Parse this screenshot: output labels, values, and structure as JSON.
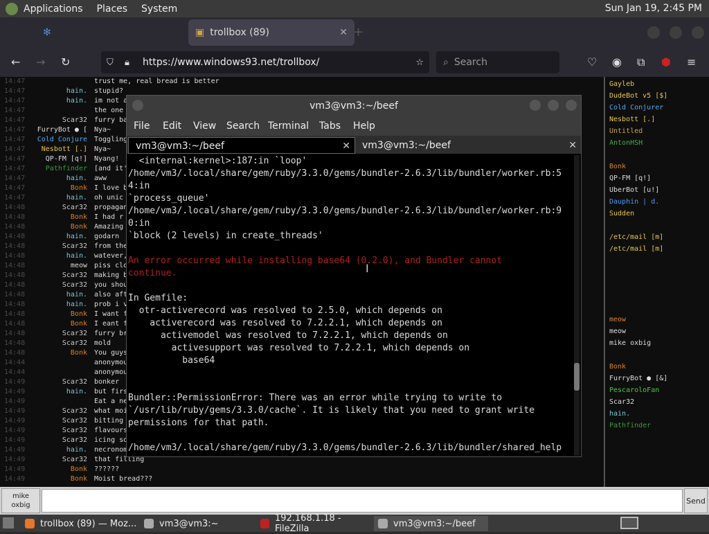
{
  "panel": {
    "applications": "Applications",
    "places": "Places",
    "system": "System",
    "clock": "Sun Jan 19,  2:45 PM"
  },
  "browser": {
    "tab_inactive": "",
    "tab_active": "trollbox (89)",
    "url": "https://www.windows93.net/trollbox/",
    "search_placeholder": "Search"
  },
  "chat": {
    "rows": [
      {
        "t": "14:47",
        "n": "",
        "nc": "#cc2222",
        "m": "trust me, real bread is better"
      },
      {
        "t": "14:47",
        "n": "hain.",
        "nc": "#7fc7d8",
        "m": "stupid?"
      },
      {
        "t": "14:47",
        "n": "hain.",
        "nc": "#7fc7d8",
        "m": "im not a"
      },
      {
        "t": "14:47",
        "n": "",
        "nc": "#cc2222",
        "m": "the one"
      },
      {
        "t": "14:47",
        "n": "Scar32",
        "nc": "#cccccc",
        "m": "furry ba"
      },
      {
        "t": "14:47",
        "n": "FurryBot ● [",
        "nc": "#dddddd",
        "m": "Nya~"
      },
      {
        "t": "14:47",
        "n": "Cold Conjure",
        "nc": "#55aaee",
        "m": "Toggling"
      },
      {
        "t": "14:47",
        "n": "Nesbott [.]",
        "nc": "#e8c84a",
        "m": "Nya~"
      },
      {
        "t": "14:47",
        "n": "QP-FM [q!]",
        "nc": "#dddddd",
        "m": "Nyang!"
      },
      {
        "t": "14:47",
        "n": "Pathfinder",
        "nc": "#3a9a3a",
        "m": "[and it'"
      },
      {
        "t": "14:47",
        "n": "hain.",
        "nc": "#7fc7d8",
        "m": "aww"
      },
      {
        "t": "14:47",
        "n": "Bonk",
        "nc": "#d9822b",
        "m": "I love b"
      },
      {
        "t": "14:47",
        "n": "hain.",
        "nc": "#7fc7d8",
        "m": "oh unic"
      },
      {
        "t": "14:48",
        "n": "Scar32",
        "nc": "#cccccc",
        "m": "propagan"
      },
      {
        "t": "14:48",
        "n": "Bonk",
        "nc": "#d9822b",
        "m": "I had r"
      },
      {
        "t": "14:48",
        "n": "Bonk",
        "nc": "#d9822b",
        "m": "Amazing"
      },
      {
        "t": "14:48",
        "n": "hain.",
        "nc": "#7fc7d8",
        "m": "godarn"
      },
      {
        "t": "14:48",
        "n": "Scar32",
        "nc": "#cccccc",
        "m": "from the"
      },
      {
        "t": "14:48",
        "n": "hain.",
        "nc": "#7fc7d8",
        "m": "watever,"
      },
      {
        "t": "14:48",
        "n": "meow",
        "nc": "#dddddd",
        "m": "piss clo"
      },
      {
        "t": "14:48",
        "n": "Scar32",
        "nc": "#cccccc",
        "m": "making b"
      },
      {
        "t": "14:48",
        "n": "Scar32",
        "nc": "#cccccc",
        "m": "you shou"
      },
      {
        "t": "14:48",
        "n": "hain.",
        "nc": "#7fc7d8",
        "m": "also aft"
      },
      {
        "t": "14:48",
        "n": "hain.",
        "nc": "#7fc7d8",
        "m": "prob i v"
      },
      {
        "t": "14:48",
        "n": "Bonk",
        "nc": "#d9822b",
        "m": "I want f"
      },
      {
        "t": "14:48",
        "n": "Bonk",
        "nc": "#d9822b",
        "m": "I eant f"
      },
      {
        "t": "14:48",
        "n": "Scar32",
        "nc": "#cccccc",
        "m": "furry br"
      },
      {
        "t": "14:48",
        "n": "Scar32",
        "nc": "#cccccc",
        "m": "mold"
      },
      {
        "t": "14:48",
        "n": "Bonk",
        "nc": "#d9822b",
        "m": "You guys"
      },
      {
        "t": "14:44",
        "n": "",
        "nc": "#cc2222",
        "m": "anonymou"
      },
      {
        "t": "14:44",
        "n": "",
        "nc": "#cc2222",
        "m": "anonymou"
      },
      {
        "t": "14:49",
        "n": "Scar32",
        "nc": "#cccccc",
        "m": "bonker"
      },
      {
        "t": "14:49",
        "n": "hain.",
        "nc": "#7fc7d8",
        "m": "but firs"
      },
      {
        "t": "14:49",
        "n": "",
        "nc": "#2255cc",
        "m": "Eat a ne"
      },
      {
        "t": "14:49",
        "n": "Scar32",
        "nc": "#cccccc",
        "m": "what moi"
      },
      {
        "t": "14:49",
        "n": "Scar32",
        "nc": "#cccccc",
        "m": "bitting"
      },
      {
        "t": "14:49",
        "n": "Scar32",
        "nc": "#cccccc",
        "m": "flavours"
      },
      {
        "t": "14:49",
        "n": "Scar32",
        "nc": "#cccccc",
        "m": "icing so"
      },
      {
        "t": "14:49",
        "n": "hain.",
        "nc": "#7fc7d8",
        "m": "necronom"
      },
      {
        "t": "14:49",
        "n": "Scar32",
        "nc": "#cccccc",
        "m": "that filling"
      },
      {
        "t": "14:49",
        "n": "Bonk",
        "nc": "#d9822b",
        "m": "??????"
      },
      {
        "t": "14:49",
        "n": "Bonk",
        "nc": "#d9822b",
        "m": "Moist bread???"
      }
    ]
  },
  "users": [
    {
      "n": "Gayleb",
      "c": "#e8c84a"
    },
    {
      "n": "DudeBot v5 [$]",
      "c": "#e8c84a"
    },
    {
      "n": "Cold Conjurer",
      "c": "#55aaee"
    },
    {
      "n": "Nesbott [.]",
      "c": "#e8c84a"
    },
    {
      "n": "Untitled",
      "c": "#c8a84a"
    },
    {
      "n": "AntonHSH",
      "c": "#4aa84a"
    },
    {
      "n": "",
      "c": "#3a6a6a"
    },
    {
      "n": "Bonk",
      "c": "#d9822b"
    },
    {
      "n": "QP-FM [q!]",
      "c": "#dddddd"
    },
    {
      "n": "UberBot [u!]",
      "c": "#dddddd"
    },
    {
      "n": "Dauphin | d.",
      "c": "#5599ee"
    },
    {
      "n": "Sudden",
      "c": "#e8c84a"
    },
    {
      "n": "",
      "c": "#2244cc"
    },
    {
      "n": "/etc/mail [m]",
      "c": "#e8c84a"
    },
    {
      "n": "/etc/mail [m]",
      "c": "#e8c84a"
    },
    {
      "n": "",
      "c": "#2244cc"
    },
    {
      "n": "",
      "c": "#3a5a3a"
    },
    {
      "n": "",
      "c": "#cc2222"
    },
    {
      "n": "",
      "c": "#888888"
    },
    {
      "n": "",
      "c": "#cc2222"
    },
    {
      "n": "meow",
      "c": "#d9822b"
    },
    {
      "n": "meow",
      "c": "#dddddd"
    },
    {
      "n": "mike oxbig",
      "c": "#dddddd"
    },
    {
      "n": "",
      "c": "#2244cc"
    },
    {
      "n": "Bonk",
      "c": "#d9822b"
    },
    {
      "n": "FurryBot ● [&]",
      "c": "#dddddd"
    },
    {
      "n": "PescaroloFan",
      "c": "#4ac84a"
    },
    {
      "n": "Scar32",
      "c": "#dddddd"
    },
    {
      "n": "hain.",
      "c": "#7fc7d8"
    },
    {
      "n": "Pathfinder",
      "c": "#3a9a3a"
    }
  ],
  "input": {
    "user_line1": "mike",
    "user_line2": "oxbig",
    "send": "Send"
  },
  "terminal": {
    "title": "vm3@vm3:~/beef",
    "menu": [
      "File",
      "Edit",
      "View",
      "Search",
      "Terminal",
      "Tabs",
      "Help"
    ],
    "tab1": "vm3@vm3:~/beef",
    "tab2": "vm3@vm3:~/beef",
    "lines": [
      {
        "s": "  <internal:kernel>:187:in `loop'",
        "c": "#dddddd"
      },
      {
        "s": "/home/vm3/.local/share/gem/ruby/3.3.0/gems/bundler-2.6.3/lib/bundler/worker.rb:5",
        "c": "#dddddd"
      },
      {
        "s": "4:in",
        "c": "#dddddd"
      },
      {
        "s": "`process_queue'",
        "c": "#dddddd"
      },
      {
        "s": "/home/vm3/.local/share/gem/ruby/3.3.0/gems/bundler-2.6.3/lib/bundler/worker.rb:9",
        "c": "#dddddd"
      },
      {
        "s": "0:in",
        "c": "#dddddd"
      },
      {
        "s": "`block (2 levels) in create_threads'",
        "c": "#dddddd"
      },
      {
        "s": "",
        "c": "#dddddd"
      },
      {
        "s": "An error occurred while installing base64 (0.2.0), and Bundler cannot",
        "c": "#b02020"
      },
      {
        "s": "continue.",
        "c": "#b02020"
      },
      {
        "s": "",
        "c": "#dddddd"
      },
      {
        "s": "In Gemfile:",
        "c": "#dddddd"
      },
      {
        "s": "  otr-activerecord was resolved to 2.5.0, which depends on",
        "c": "#dddddd"
      },
      {
        "s": "    activerecord was resolved to 7.2.2.1, which depends on",
        "c": "#dddddd"
      },
      {
        "s": "      activemodel was resolved to 7.2.2.1, which depends on",
        "c": "#dddddd"
      },
      {
        "s": "        activesupport was resolved to 7.2.2.1, which depends on",
        "c": "#dddddd"
      },
      {
        "s": "          base64",
        "c": "#dddddd"
      },
      {
        "s": "",
        "c": "#dddddd"
      },
      {
        "s": "",
        "c": "#dddddd"
      },
      {
        "s": "Bundler::PermissionError: There was an error while trying to write to",
        "c": "#dddddd"
      },
      {
        "s": "`/usr/lib/ruby/gems/3.3.0/cache`. It is likely that you need to grant write",
        "c": "#dddddd"
      },
      {
        "s": "permissions for that path.",
        "c": "#dddddd"
      },
      {
        "s": "",
        "c": "#dddddd"
      },
      {
        "s": "/home/vm3/.local/share/gem/ruby/3.3.0/gems/bundler-2.6.3/lib/bundler/shared_help",
        "c": "#dddddd"
      }
    ]
  },
  "taskbar": [
    {
      "label": "trollbox (89) — Moz...",
      "icon": "firefox-icon"
    },
    {
      "label": "vm3@vm3:~",
      "icon": "terminal-icon"
    },
    {
      "label": "192.168.1.18 - FileZilla",
      "icon": "filezilla-icon"
    },
    {
      "label": "vm3@vm3:~/beef",
      "icon": "terminal-icon"
    }
  ],
  "colors": {
    "error": "#b02020",
    "panel": "#3a3a3a",
    "terminal_bg": "#000000"
  }
}
